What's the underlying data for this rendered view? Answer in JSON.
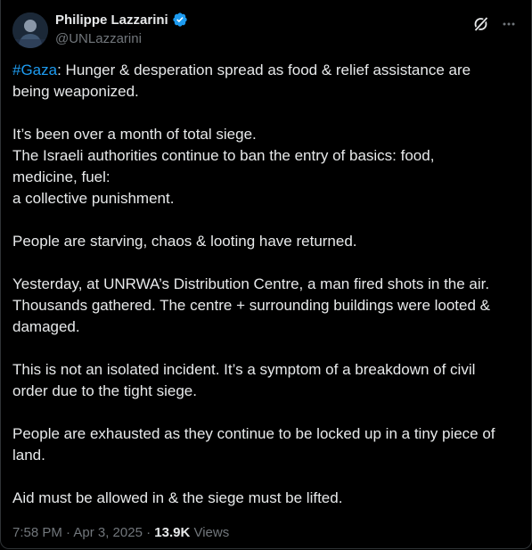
{
  "author": {
    "display_name": "Philippe Lazzarini",
    "handle": "@UNLazzarini",
    "verified_icon": "verified-badge-icon",
    "accent_color": "#1d9bf0"
  },
  "header_actions": {
    "grok_icon": "grok-icon",
    "more_icon": "more-horizontal-icon"
  },
  "post": {
    "hashtag": "#Gaza",
    "p1_rest_line1": ": Hunger & desperation spread as food & relief assistance are",
    "p1_line2": "being weaponized.",
    "p2_line1": "It’s been over a month of total siege.",
    "p2_line2": "The Israeli authorities continue to ban the entry of basics: food,",
    "p2_line3": "medicine, fuel:",
    "p2_line4": "a collective punishment.",
    "p3_line1": "People are starving, chaos & looting have returned.",
    "p4_line1": "Yesterday, at UNRWA’s Distribution Centre, a man fired shots in the air.",
    "p4_line2": "Thousands gathered. The centre + surrounding buildings were looted &",
    "p4_line3": "damaged.",
    "p5_line1": "This is not an isolated incident. It’s a symptom of a breakdown of civil",
    "p5_line2": "order due to the tight siege.",
    "p6_line1": "People are exhausted as they continue to be locked up in a tiny piece of",
    "p6_line2": "land.",
    "p7_line1": "Aid must be allowed in & the siege must be lifted."
  },
  "meta": {
    "timestamp": "7:58 PM · Apr 3, 2025 · ",
    "views_count": "13.9K",
    "views_label": " Views"
  },
  "colors": {
    "background": "#000000",
    "text": "#e7e9ea",
    "secondary_text": "#71767b",
    "link": "#1d9bf0",
    "border": "#2f3336"
  }
}
